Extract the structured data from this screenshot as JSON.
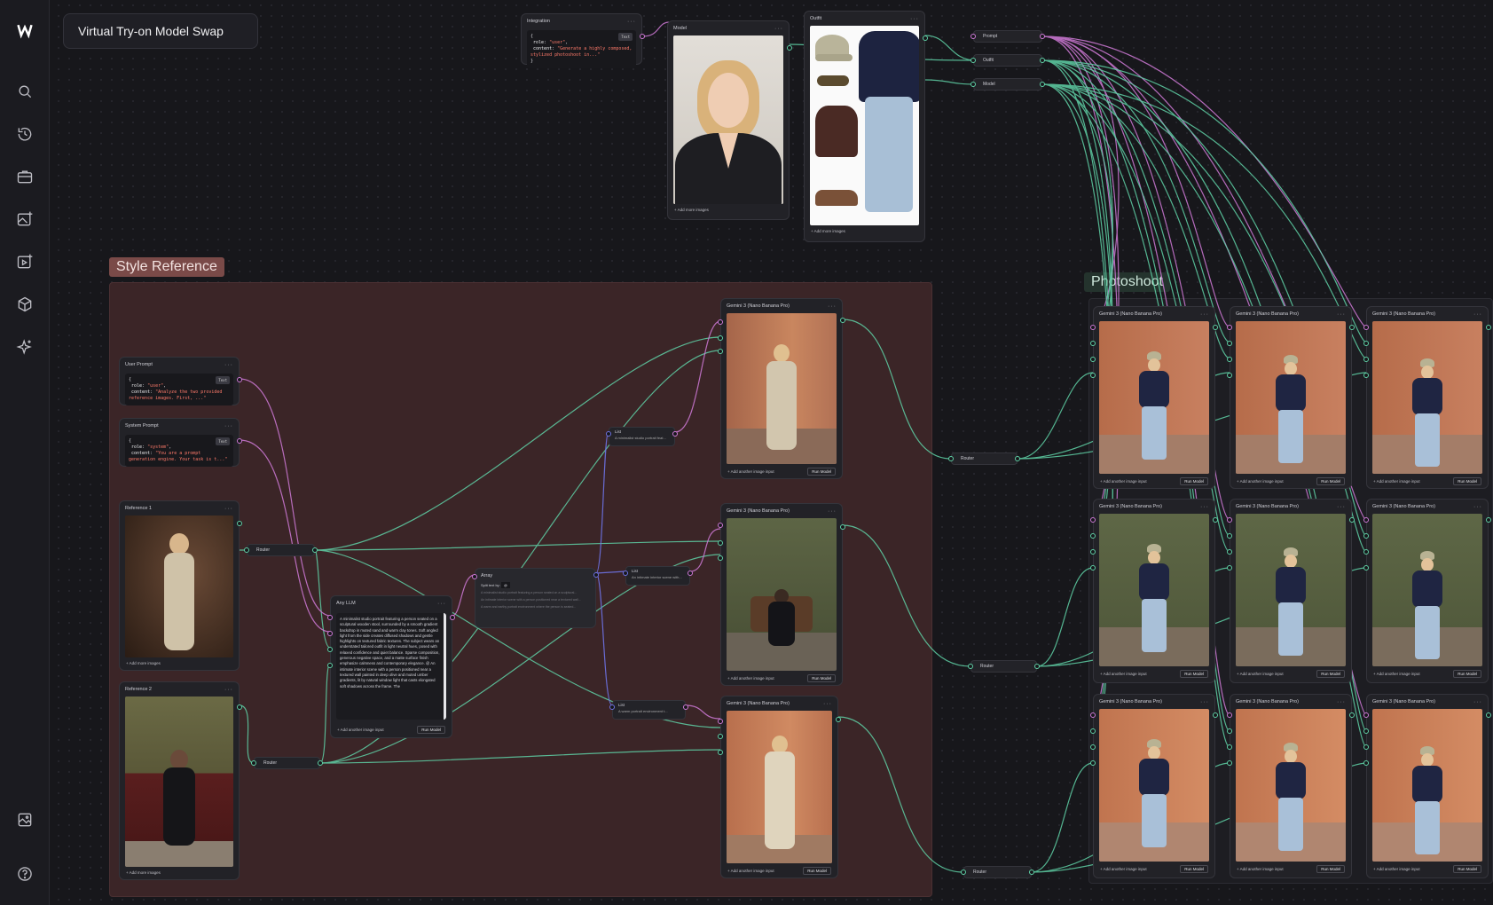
{
  "app": {
    "title": "Virtual Try-on Model Swap"
  },
  "colors": {
    "canvas": "#17171b",
    "node": "#222227",
    "wire_green": "#5fd1a6",
    "wire_pink": "#d07ad8",
    "wire_blue": "#6e73e6",
    "style_group": "#3b2527",
    "style_label_bg": "#7a4a48"
  },
  "sidebar": {
    "items": [
      "logo-icon",
      "search-icon",
      "history-icon",
      "briefcase-icon",
      "image-plus-icon",
      "video-plus-icon",
      "cube-icon",
      "sparkle-icon",
      "gallery-icon",
      "help-icon"
    ]
  },
  "groups": {
    "style_reference": {
      "label": "Style Reference"
    },
    "photoshoot": {
      "label": "Photoshoot"
    }
  },
  "nodes": {
    "integration": {
      "title": "Integration",
      "line1_key": "role",
      "line1_val": "\"user\"",
      "line2_key": "content",
      "line2_val": "\"Generate a highly composed, stylized photoshoot in...\"",
      "badge": "Text"
    },
    "model": {
      "title": "Model",
      "footer": "+ Add more images"
    },
    "outfit": {
      "title": "Outfit",
      "footer": "+ Add more images"
    },
    "prompt_out": {
      "title": "Prompt"
    },
    "outfit_out": {
      "title": "Outfit"
    },
    "model_out": {
      "title": "Model"
    },
    "user_prompt": {
      "title": "User Prompt",
      "line1_key": "role",
      "line1_val": "\"user\"",
      "line2_key": "content",
      "line2_val": "\"Analyze the two provided reference images. First, ...\"",
      "badge": "Text"
    },
    "system_prompt": {
      "title": "System Prompt",
      "line1_key": "role",
      "line1_val": "\"system\"",
      "line2_key": "content",
      "line2_val": "\"You are a prompt generation engine. Your task is t...\"",
      "badge": "Text"
    },
    "reference1": {
      "title": "Reference 1",
      "footer": "+ Add more images"
    },
    "reference2": {
      "title": "Reference 2",
      "footer": "+ Add more images"
    },
    "router": {
      "title": "Router"
    },
    "any_llm": {
      "title": "Any LLM",
      "text": "A minimalist studio portrait featuring a person seated on a sculptural wooden stool, surrounded by a smooth gradient backdrop in muted sand and warm clay tones. Soft angled light from the side creates diffused shadows and gentle highlights on textured fabric textures. The subject wears an understated tailored outfit in light neutral hues, posed with relaxed confidence and quiet balance. Sparse composition, generous negative space, and a matte surface finish emphasize calmness and contemporary elegance. @ An intimate interior scene with a person positioned near a textured wall painted in deep olive and muted umber gradients, lit by natural window light that casts elongated soft shadows across the frame. The",
      "footer_add": "+ Add another image input",
      "run": "Run Model"
    },
    "array": {
      "title": "Array",
      "split_label": "Split text by:",
      "split_val": "@",
      "rows": [
        "A minimalist studio portrait featuring a person seated on a sculptural...",
        "An intimate interior scene with a person positioned near a textured wall...",
        "A warm and earthy portrait environment where the person is seated..."
      ]
    },
    "list1": {
      "title": "List",
      "text": "A minimalist studio portrait feat..."
    },
    "list2": {
      "title": "List",
      "text": "An intimate interior scene with..."
    },
    "list3": {
      "title": "List",
      "text": "A warm portrait environment t..."
    },
    "gemini": {
      "title": "Gemini 3 (Nano Banana Pro)",
      "footer_add": "+ Add another image input",
      "run": "Run Model"
    }
  }
}
